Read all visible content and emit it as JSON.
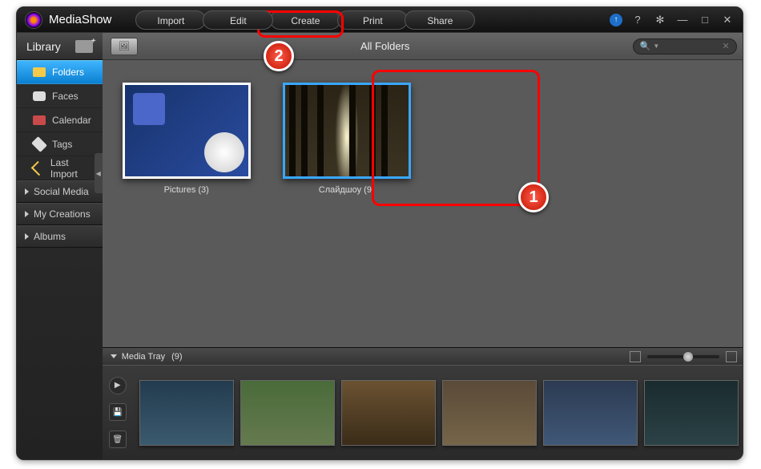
{
  "app_title": "MediaShow",
  "menu": [
    "Import",
    "Edit",
    "Create",
    "Print",
    "Share"
  ],
  "titlebar_icons": {
    "update": "↑",
    "help": "?",
    "settings": "✻",
    "minimize": "—",
    "maximize": "□",
    "close": "✕"
  },
  "sidebar": {
    "header": "Library",
    "items": [
      {
        "label": "Folders",
        "active": true
      },
      {
        "label": "Faces",
        "active": false
      },
      {
        "label": "Calendar",
        "active": false
      },
      {
        "label": "Tags",
        "active": false
      },
      {
        "label": "Last Import",
        "active": false
      }
    ],
    "sections": [
      "Social Media",
      "My Creations",
      "Albums"
    ]
  },
  "breadcrumb": {
    "title": "All Folders",
    "search_placeholder": ""
  },
  "search_icon": "🔍",
  "folders": [
    {
      "label": "Pictures (3)",
      "selected": false,
      "art": "dj"
    },
    {
      "label": "Слайдшоу (9)",
      "selected": true,
      "art": "forest"
    }
  ],
  "tray": {
    "header": "Media Tray",
    "count": "(9)",
    "controls": {
      "play": "▶",
      "save": "💾",
      "delete": "🗑"
    }
  },
  "annotations": {
    "badge1": "1",
    "badge2": "2"
  }
}
